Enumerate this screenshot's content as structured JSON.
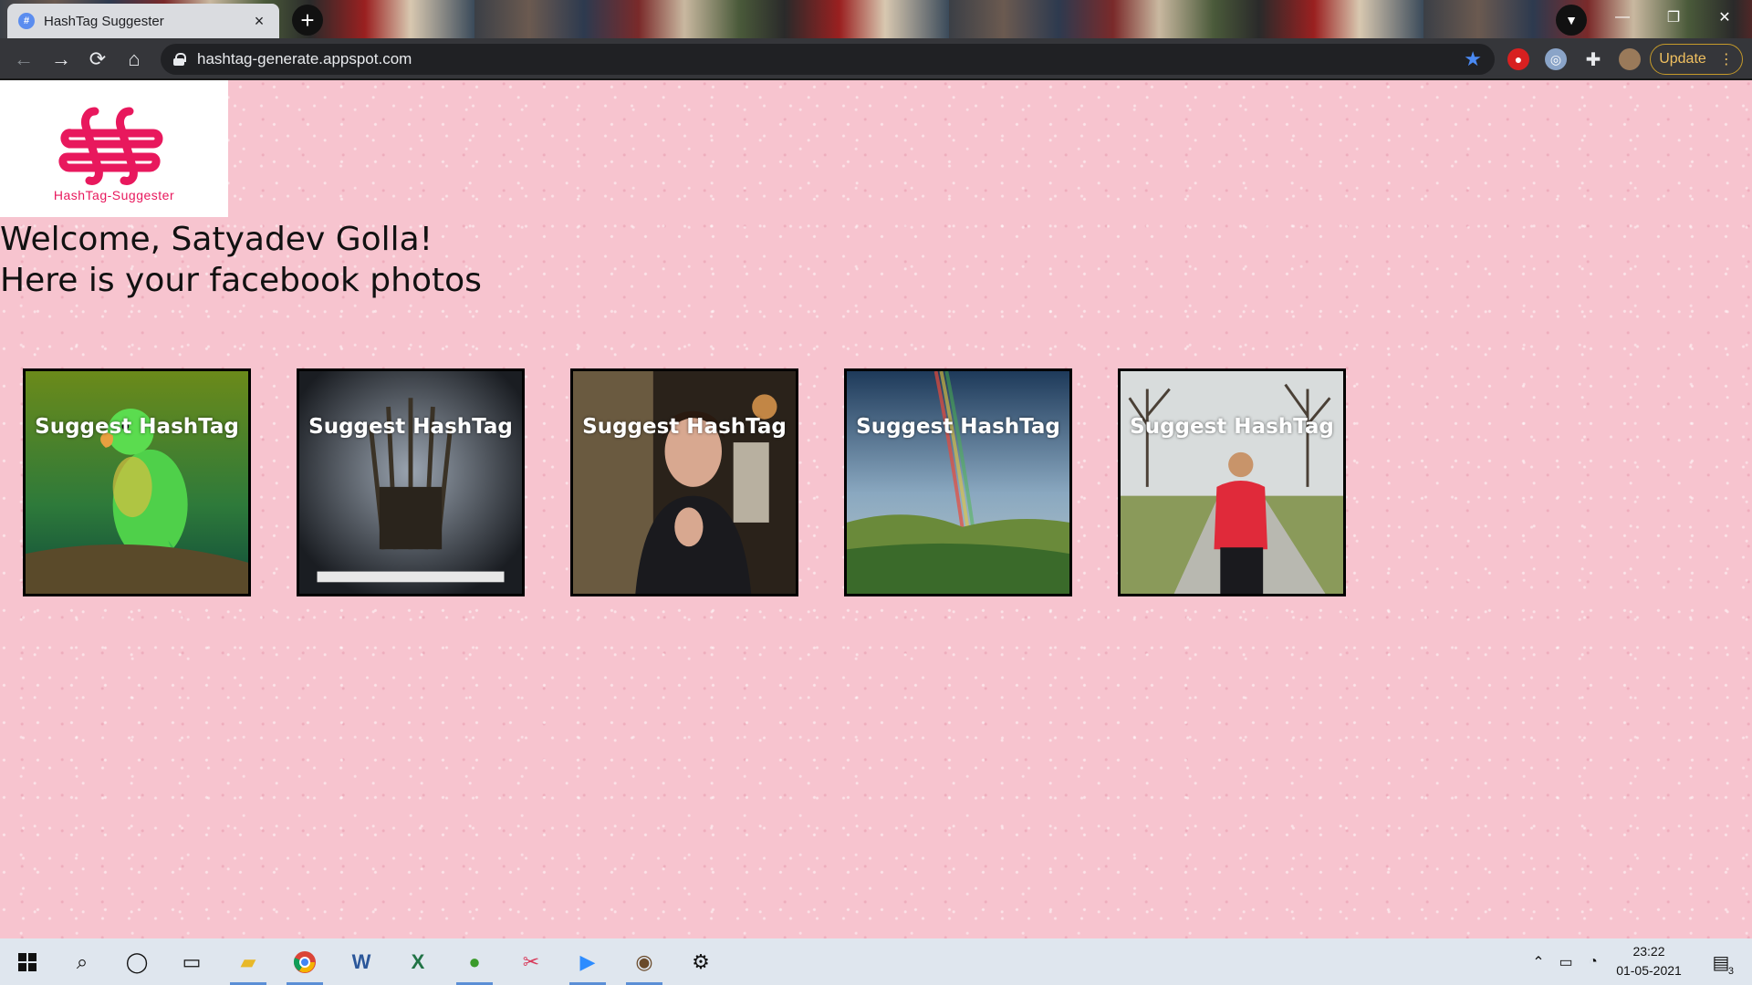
{
  "browser": {
    "tab_title": "HashTag Suggester",
    "tab_close": "×",
    "new_tab": "+",
    "url": "hashtag-generate.appspot.com",
    "update_label": "Update",
    "menu": "⋮",
    "nav": {
      "back": "←",
      "forward": "→",
      "reload": "⟳",
      "home": "⌂"
    },
    "window": {
      "minimize": "—",
      "restore": "❐",
      "close": "✕"
    }
  },
  "logo": {
    "text": "HashTag-Suggester",
    "color": "#e8185d"
  },
  "welcome": {
    "line1": "Welcome, Satyadev Golla!",
    "line2": "Here is your facebook photos"
  },
  "photos": [
    {
      "label": "Suggest HashTag",
      "subject": "green-parrot"
    },
    {
      "label": "Suggest HashTag",
      "subject": "iron-throne"
    },
    {
      "label": "Suggest HashTag",
      "subject": "man-in-suit"
    },
    {
      "label": "Suggest HashTag",
      "subject": "rainbow-landscape"
    },
    {
      "label": "Suggest HashTag",
      "subject": "man-in-red-hoodie"
    }
  ],
  "taskbar": {
    "time": "23:22",
    "date": "01-05-2021",
    "notifications": "3"
  },
  "colors": {
    "page_bg": "#f7c4cf",
    "accent": "#e8185d",
    "update_border": "#c59a2a"
  }
}
